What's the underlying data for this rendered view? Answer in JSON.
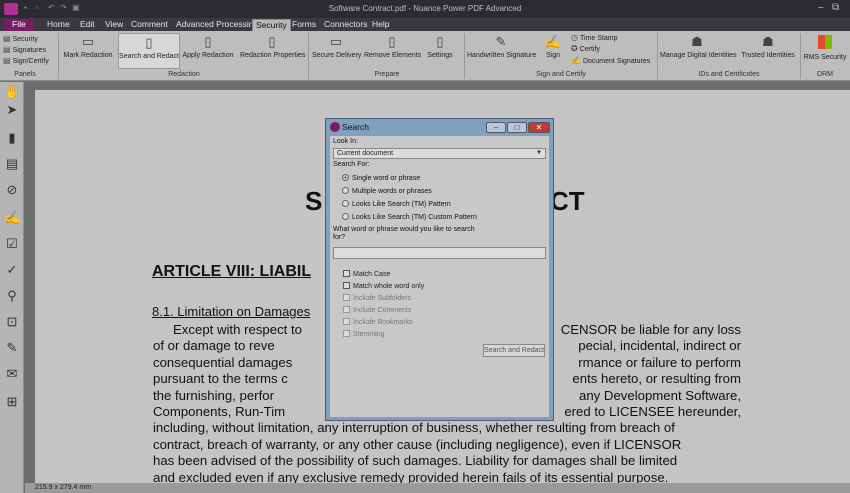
{
  "window": {
    "title": "Software Contract.pdf - Nuance Power PDF Advanced",
    "minimize_glyph": "–",
    "restore_glyph": "⧉"
  },
  "menu": {
    "file": "File",
    "tabs": [
      "Home",
      "Edit",
      "View",
      "Comment",
      "Advanced Processing",
      "Security",
      "Forms",
      "Connectors",
      "Help"
    ],
    "active": "Security"
  },
  "ribbon": {
    "panels_items": [
      "Security",
      "Signatures",
      "Sign/Certify"
    ],
    "buttons": {
      "mark_redaction": "Mark Redaction",
      "search_redact": "Search and Redact",
      "apply_redaction": "Apply Redaction",
      "redaction_properties": "Redaction Properties",
      "secure_delivery": "Secure Delivery",
      "remove_elements": "Remove Elements",
      "settings": "Settings",
      "handwritten_signature": "Handwritten Signature",
      "sign": "Sign",
      "time_stamp": "Time Stamp",
      "certify": "Certify",
      "document_signatures": "Document Signatures",
      "manage_digital_ids": "Manage Digital Identities",
      "trusted_ids": "Trusted Identities",
      "rms_security": "RMS Security"
    },
    "groups": {
      "panels": "Panels",
      "redaction": "Redaction",
      "prepare": "Prepare",
      "sign_certify": "Sign and Certify",
      "ids_certs": "IDs and Certificates",
      "drm": "DRM"
    }
  },
  "document": {
    "heading_left": "S",
    "heading_right": "CT",
    "article": "ARTICLE VIII: LIABIL",
    "subheading": "8.1. Limitation on Damages",
    "lines": [
      [
        "Except with respect to",
        "CENSOR be liable for any loss"
      ],
      [
        "of or damage to reve",
        "pecial, incidental, indirect or"
      ],
      [
        "consequential damages",
        "rmance or failure to perform"
      ],
      [
        "pursuant to the terms c",
        "ents hereto, or resulting from"
      ],
      [
        "the furnishing, perfor",
        "any Development Software,"
      ],
      [
        "Components, Run-Tim",
        "ered to LICENSEE hereunder,"
      ]
    ],
    "full_lines": [
      "including, without limitation, any interruption of business, whether resulting from breach of",
      "contract, breach of warranty, or any other cause (including negligence), even if LICENSOR",
      "has been advised of the possibility of such damages. Liability for damages shall be limited",
      "and excluded even if any exclusive remedy provided herein fails of its essential purpose."
    ]
  },
  "status": {
    "page_size": "215.9 x 279.4 mm"
  },
  "dialog": {
    "title": "Search",
    "look_in_label": "Look In:",
    "look_in_value": "Current document",
    "search_for_label": "Search For:",
    "options": [
      "Single word or phrase",
      "Multiple words or phrases",
      "Looks Like Search (TM) Pattern",
      "Looks Like Search (TM) Custom Pattern"
    ],
    "selected_option": "Single word or phrase",
    "question": "What word or phrase would you like to search for?",
    "search_value": "",
    "checkboxes": [
      {
        "label": "Match Case",
        "enabled": true
      },
      {
        "label": "Match whole word only",
        "enabled": true
      },
      {
        "label": "Include Subfolders",
        "enabled": false
      },
      {
        "label": "Include Comments",
        "enabled": false
      },
      {
        "label": "Include Bookmarks",
        "enabled": false
      },
      {
        "label": "Stemming",
        "enabled": false
      }
    ],
    "search_button": "Search and Redact",
    "minimize_glyph": "–",
    "maximize_glyph": "□",
    "close_glyph": "✕"
  }
}
